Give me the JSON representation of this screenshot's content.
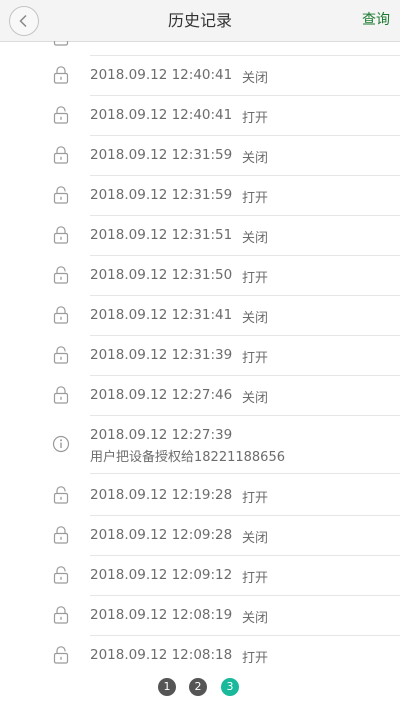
{
  "header": {
    "title": "历史记录",
    "query_label": "查询"
  },
  "records": [
    {
      "icon": "lock-closed-icon",
      "time": "2018.09.12 12:40:41",
      "action": "关闭"
    },
    {
      "icon": "lock-open-icon",
      "time": "2018.09.12 12:40:41",
      "action": "打开"
    },
    {
      "icon": "lock-closed-icon",
      "time": "2018.09.12 12:31:59",
      "action": "关闭"
    },
    {
      "icon": "lock-open-icon",
      "time": "2018.09.12 12:31:59",
      "action": "打开"
    },
    {
      "icon": "lock-closed-icon",
      "time": "2018.09.12 12:31:51",
      "action": "关闭"
    },
    {
      "icon": "lock-open-icon",
      "time": "2018.09.12 12:31:50",
      "action": "打开"
    },
    {
      "icon": "lock-closed-icon",
      "time": "2018.09.12 12:31:41",
      "action": "关闭"
    },
    {
      "icon": "lock-open-icon",
      "time": "2018.09.12 12:31:39",
      "action": "打开"
    },
    {
      "icon": "lock-closed-icon",
      "time": "2018.09.12 12:27:46",
      "action": "关闭"
    },
    {
      "icon": "info-icon",
      "time": "2018.09.12 12:27:39",
      "message": "用户把设备授权给18221188656"
    },
    {
      "icon": "lock-open-icon",
      "time": "2018.09.12 12:19:28",
      "action": "打开"
    },
    {
      "icon": "lock-closed-icon",
      "time": "2018.09.12 12:09:28",
      "action": "关闭"
    },
    {
      "icon": "lock-open-icon",
      "time": "2018.09.12 12:09:12",
      "action": "打开"
    },
    {
      "icon": "lock-closed-icon",
      "time": "2018.09.12 12:08:19",
      "action": "关闭"
    },
    {
      "icon": "lock-open-icon",
      "time": "2018.09.12 12:08:18",
      "action": "打开"
    }
  ],
  "pagination": {
    "pages": [
      "1",
      "2",
      "3"
    ],
    "current": "3"
  },
  "colors": {
    "accent": "#1ab99b",
    "query": "#1a7a2e",
    "inactive_page": "#555555"
  }
}
